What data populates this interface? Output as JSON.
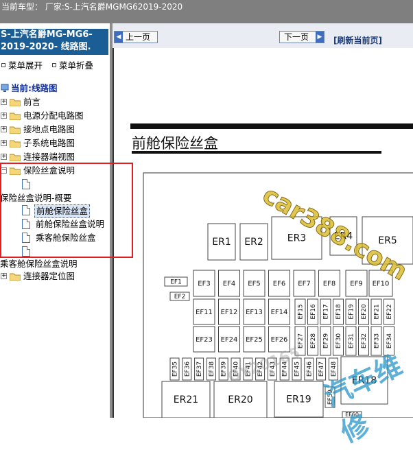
{
  "topbar": {
    "text": "当前车型： 厂家:S-上汽名爵MGMG62019-2020"
  },
  "sidebar": {
    "header": "S-上汽名爵MG-MG6-2019-2020- 线路图.",
    "expand_label": "菜单展开",
    "collapse_label": "菜单折叠",
    "current_label": "当前:线路图",
    "items": [
      {
        "label": "前言"
      },
      {
        "label": "电源分配电路图"
      },
      {
        "label": "接地点电路图"
      },
      {
        "label": "子系统电路图"
      },
      {
        "label": "连接器端视图"
      },
      {
        "label": "保险丝盒说明"
      },
      {
        "label": "保险丝盒说明-概要"
      },
      {
        "label": "前舱保险丝盒"
      },
      {
        "label": "前舱保险丝盒说明"
      },
      {
        "label": "乘客舱保险丝盒"
      },
      {
        "label": "乘客舱保险丝盒说明"
      },
      {
        "label": "连接器定位图"
      }
    ]
  },
  "nav": {
    "prev_label": "上一页",
    "next_label": "下一页",
    "refresh_label": "[刷新当前页]"
  },
  "diagram": {
    "title": "前舱保险丝盒",
    "relays": [
      "ER1",
      "ER2",
      "ER3",
      "ER4",
      "ER5",
      "ER18",
      "ER19",
      "ER20",
      "ER21"
    ],
    "fuses_row1": [
      "EF1",
      "EF2",
      "EF3",
      "EF4",
      "EF5",
      "EF6",
      "EF7",
      "EF8",
      "EF9",
      "EF10"
    ],
    "fuses_row2": [
      "EF11",
      "EF12",
      "EF13",
      "EF14",
      "EF15",
      "EF16",
      "EF17",
      "EF18",
      "EF19",
      "EF20",
      "EF21",
      "EF22"
    ],
    "fuses_row3": [
      "EF23",
      "EF24",
      "EF25",
      "EF26",
      "EF27",
      "EF28",
      "EF29",
      "EF30",
      "EF31",
      "EF32",
      "EF33",
      "EF34"
    ],
    "fuses_row4": [
      "EF35",
      "EF36",
      "EF37",
      "EF38",
      "EF39",
      "EF40",
      "EF41",
      "EF42",
      "EF43",
      "EF44",
      "EF45",
      "EF46",
      "EF47",
      "EF48"
    ],
    "fuses_misc": [
      "EF59",
      "EF60"
    ]
  },
  "watermarks": {
    "site": "car388.com",
    "brand": "汽车维修",
    "code": "GY20165"
  },
  "colors": {
    "header_bg": "#1b5e96",
    "highlight_box": "#e02020",
    "topbar_bg": "#7f7f7f"
  }
}
